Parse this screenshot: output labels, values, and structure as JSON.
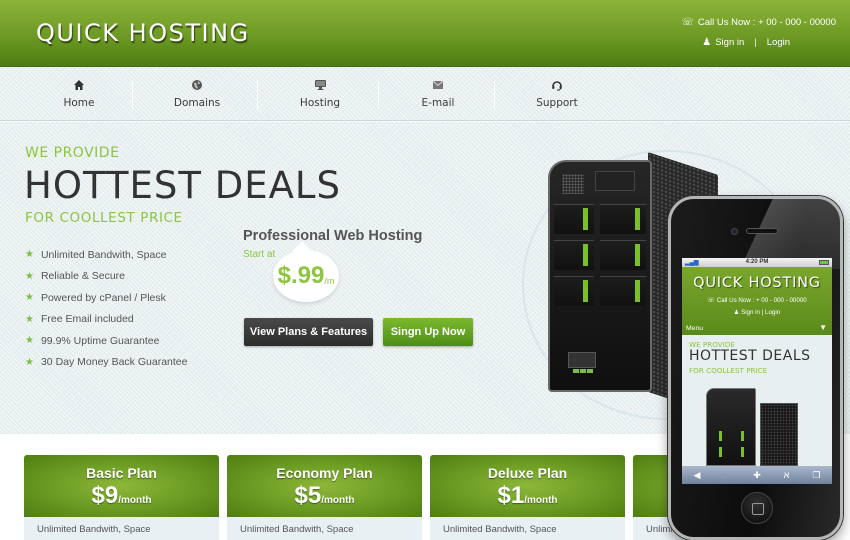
{
  "header": {
    "logo": "QUICK HOSTING",
    "call_label": "Call Us Now : + 00 - 000 - 00000",
    "sign_in": "Sign in",
    "separator": "|",
    "login": "Login",
    "phone_icon": "telephone-icon",
    "user_icon": "user-icon"
  },
  "nav": {
    "items": [
      {
        "label": "Home",
        "icon": "home-icon",
        "glyph": "⌂"
      },
      {
        "label": "Domains",
        "icon": "globe-icon",
        "glyph": "◒"
      },
      {
        "label": "Hosting",
        "icon": "monitor-icon",
        "glyph": "▭"
      },
      {
        "label": "E-mail",
        "icon": "envelope-icon",
        "glyph": "✉"
      },
      {
        "label": "Support",
        "icon": "headset-icon",
        "glyph": "☊"
      }
    ]
  },
  "hero": {
    "we_provide": "WE PROVIDE",
    "headline": "HOTTEST DEALS",
    "subline": "FOR COOLLEST PRICE",
    "features": [
      "Unlimited Bandwith, Space",
      "Reliable & Secure",
      "Powered by cPanel / Plesk",
      "Free Email included",
      "99.9% Uptime Guarantee",
      "30 Day Money Back Guarantee"
    ],
    "promo_title": "Professional Web Hosting",
    "start_at": "Start at",
    "price": "$.99",
    "price_unit": "/m",
    "view_plans_button": "View Plans & Features",
    "signup_button": "Singn Up Now"
  },
  "plans": [
    {
      "name": "Basic Plan",
      "price": "$9",
      "unit": "/month",
      "feature": "Unlimited Bandwith, Space"
    },
    {
      "name": "Economy Plan",
      "price": "$5",
      "unit": "/month",
      "feature": "Unlimited Bandwith, Space"
    },
    {
      "name": "Deluxe Plan",
      "price": "$1",
      "unit": "/month",
      "feature": "Unlimited Bandwith, Space"
    },
    {
      "name": "",
      "price": "",
      "unit": "",
      "feature": "Unlimit"
    }
  ],
  "phone_mockup": {
    "time": "4:20 PM",
    "logo": "QUICK HOSTING",
    "call_label": "Call Us Now : + 00 - 000 - 00000",
    "sign_line": "Sign in | Login",
    "menu": "Menu",
    "we_provide": "WE PROVIDE",
    "headline": "HOTTEST DEALS",
    "subline": "FOR COOLLEST PRICE",
    "toolbar": [
      "back-icon",
      "forward-icon",
      "add-icon",
      "bookmarks-icon",
      "tabs-icon"
    ]
  },
  "colors": {
    "brand_green": "#6c9a24",
    "accent_green": "#8cc53f",
    "dark_button": "#333333",
    "text_dark": "#333333"
  }
}
